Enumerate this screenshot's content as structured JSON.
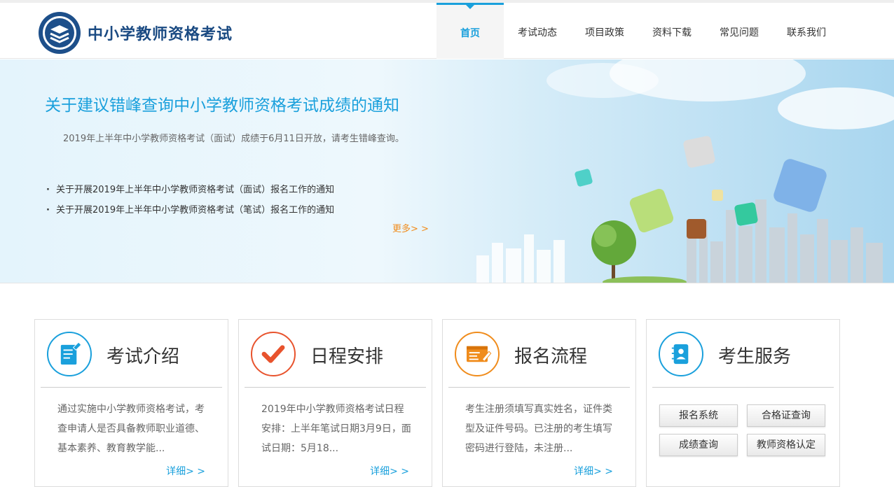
{
  "site": {
    "title": "中小学教师资格考试"
  },
  "nav": [
    {
      "label": "首页",
      "active": true
    },
    {
      "label": "考试动态"
    },
    {
      "label": "项目政策"
    },
    {
      "label": "资料下载"
    },
    {
      "label": "常见问题"
    },
    {
      "label": "联系我们"
    }
  ],
  "banner": {
    "headline": "关于建议错峰查询中小学教师资格考试成绩的通知",
    "summary": "2019年上半年中小学教师资格考试（面试）成绩于6月11日开放，请考生错峰查询。",
    "news": [
      "关于开展2019年上半年中小学教师资格考试（面试）报名工作的通知",
      "关于开展2019年上半年中小学教师资格考试（笔试）报名工作的通知"
    ],
    "more": "更多> >"
  },
  "cards": [
    {
      "title": "考试介绍",
      "icon": "document-edit-icon",
      "desc": "通过实施中小学教师资格考试，考查申请人是否具备教师职业道德、基本素养、教育教学能...",
      "more": "详细> >"
    },
    {
      "title": "日程安排",
      "icon": "checkmark-icon",
      "desc": "2019年中小学教师资格考试日程安排：上半年笔试日期3月9日，面试日期：5月18...",
      "more": "详细> >"
    },
    {
      "title": "报名流程",
      "icon": "registration-form-icon",
      "desc": "考生注册须填写真实姓名，证件类型及证件号码。已注册的考生填写密码进行登陆，未注册...",
      "more": "详细> >"
    },
    {
      "title": "考生服务",
      "icon": "contacts-book-icon",
      "buttons": [
        "报名系统",
        "合格证查询",
        "成绩查询",
        "教师资格认定"
      ]
    }
  ],
  "colors": {
    "accent": "#1aa0dc",
    "more": "#f08c1c",
    "check": "#e8532d",
    "form": "#f08c1c"
  }
}
